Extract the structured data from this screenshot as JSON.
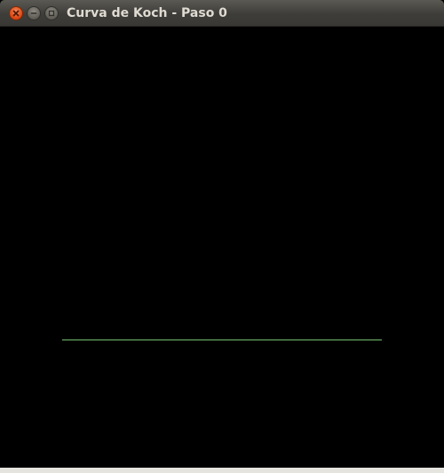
{
  "window": {
    "title": "Curva de Koch - Paso 0"
  },
  "controls": {
    "close_icon": "close-icon",
    "minimize_icon": "minimize-icon",
    "maximize_icon": "maximize-icon"
  },
  "colors": {
    "canvas_background": "#000000",
    "curve": "#7fd47a",
    "close_button": "#df4b16"
  },
  "koch": {
    "step": 0,
    "segments": 1
  }
}
